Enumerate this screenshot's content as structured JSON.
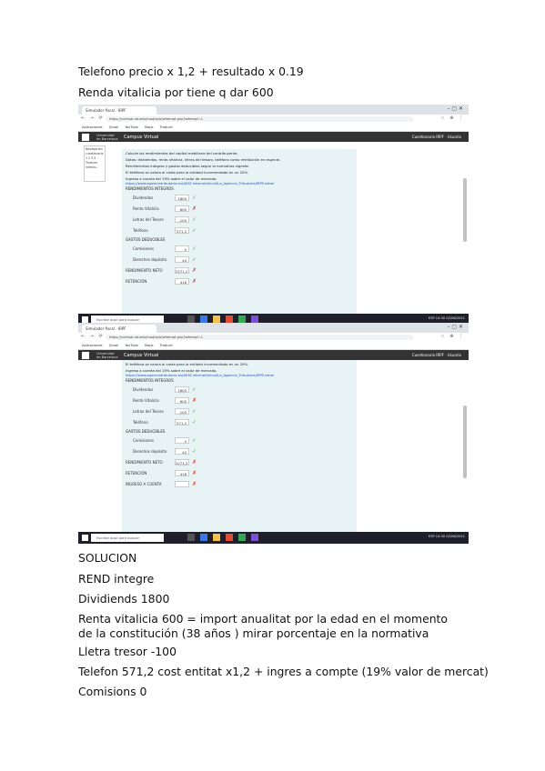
{
  "doc": {
    "line1": "Telefono precio x 1,2 + resultado x 0.19",
    "line2": "Renda vitalicia por tiene  q dar 600",
    "solution_title": "SOLUCION",
    "rend": "REND integre",
    "dividends": "Dividiends 1800",
    "renta": "Renta vitalicia 600 = import anualitat por la edad en el momento de la constitución (38 años ) mirar porcentaje en la normativa",
    "lletra": "Lletra tresor -100",
    "telefon": "Telefon 571,2 cost entitat x1,2 + ingres a compte (19% valor de mercat)",
    "comisions": "Comisions 0"
  },
  "browser": {
    "tab_title": "Simulador fiscal - IRPF",
    "url": "https://cvirtual.ub.edu/mod/quiz/attempt.php?attempt=1"
  },
  "bookmarks": [
    "Aplicaciones",
    "Gmail",
    "YouTube",
    "Maps",
    "Traducir"
  ],
  "site": {
    "brand_line1": "Universitat",
    "brand_line2": "de Barcelona",
    "name": "Campus Virtual",
    "user": "Cuestionario IRPF  ·  Usuario"
  },
  "nav_box": [
    "Navegación",
    "cuestionario",
    "1 2 3 4",
    "Finalizar",
    "intento..."
  ],
  "question": {
    "text_1": "Calcule los rendimientos del capital mobiliario del contribuyente.",
    "text_2": "Datos: dividendos, renta vitalicia, letras del tesoro, teléfono como retribución en especie.",
    "text_3": "Rendimientos integros y gastos deducibles según la normativa vigente.",
    "text_4": "El teléfono se valora al coste para la entidad incrementado en un 20%.",
    "text_5": "Ingreso a cuenta del 19% sobre el valor de mercado.",
    "link": "https://www.agenciatributaria.es/AEAT.internet/Inicio/La_Agencia_Tributaria/IRPF.shtml",
    "integros_heading": "RENDIMIENTOS INTEGROS",
    "gastos_heading": "GASTOS DEDUCIBLES",
    "rows_int": [
      {
        "label": "Dividendos",
        "value": "1800",
        "ok": true
      },
      {
        "label": "Renta Vitalicia",
        "value": "600",
        "ok": false
      },
      {
        "label": "Letras del Tesoro",
        "value": "-100",
        "ok": true
      },
      {
        "label": "Teléfono",
        "value": "571,2",
        "ok": true
      }
    ],
    "rows_gas": [
      {
        "label": "Comisiones",
        "value": "0",
        "ok": true
      },
      {
        "label": "Derechos depósito",
        "value": "40",
        "ok": true
      }
    ],
    "rend_neto": {
      "label": "RENDIMIENTO NETO",
      "value": "2271,2",
      "ok": false
    },
    "retencion": {
      "label": "RETENCIÓN",
      "value": "418",
      "ok": false
    },
    "ingreso_cuenta": {
      "label": "INGRESO A CUENTA",
      "value": "",
      "ok": false
    }
  },
  "taskbar": {
    "search_placeholder": "Escribe aquí para buscar",
    "tray": "ESP  14:30  02/06/2021"
  },
  "colors": {
    "page_bg": "#ffffff",
    "quiz_panel": "#e7f3f5",
    "site_header": "#333333",
    "ok": "#4caf50",
    "bad": "#d93025",
    "taskbar": "#1f1f2c"
  }
}
